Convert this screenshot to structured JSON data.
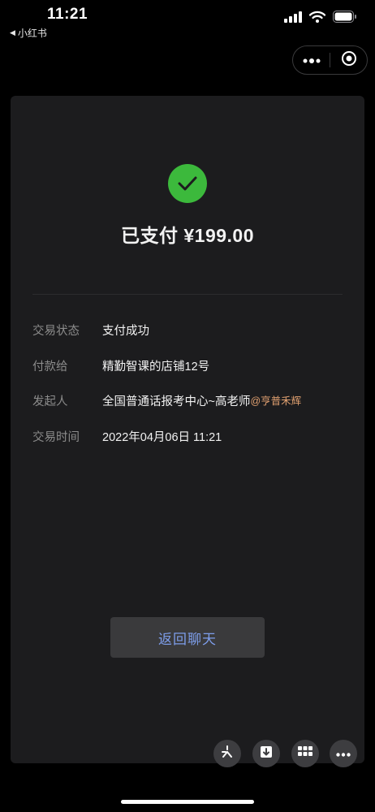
{
  "status_bar": {
    "time": "11:21",
    "back_app": "小红书"
  },
  "payment": {
    "title": "已支付 ¥199.00",
    "rows": [
      {
        "label": "交易状态",
        "value": "支付成功",
        "mention": ""
      },
      {
        "label": "付款给",
        "value": "精勤智课的店铺12号",
        "mention": ""
      },
      {
        "label": "发起人",
        "value": "全国普通话报考中心~高老师",
        "mention": "@亨普禾辉"
      },
      {
        "label": "交易时间",
        "value": "2022年04月06日 11:21",
        "mention": ""
      }
    ],
    "return_button": "返回聊天"
  },
  "colors": {
    "success_green": "#3cb93c",
    "button_text_blue": "#7d9dea",
    "mention_orange": "#e0a070",
    "card_bg": "#1c1c1e"
  },
  "icons": [
    "signal-icon",
    "wifi-icon",
    "battery-icon",
    "more-icon",
    "target-icon",
    "checkmark-icon",
    "sparkle-icon",
    "download-icon",
    "grid-icon",
    "ellipsis-icon"
  ]
}
